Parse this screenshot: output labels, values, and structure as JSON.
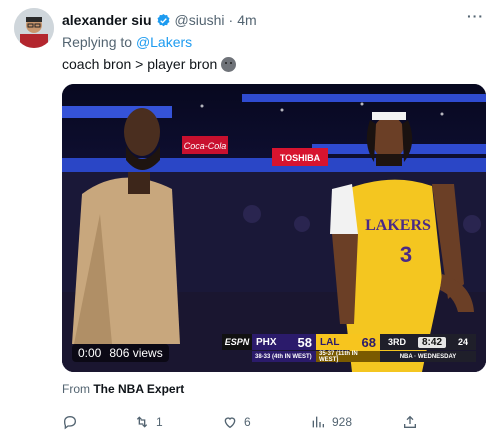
{
  "tweet": {
    "display_name": "alexander siu",
    "handle": "@siushi",
    "separator": "·",
    "time": "4m",
    "more": "···",
    "replying_prefix": "Replying to ",
    "replying_to": "@Lakers",
    "text": "coach bron > player bron",
    "emoji": "neutral-face-emoji"
  },
  "media": {
    "timestamp": "0:00",
    "views_overlay": "806 views",
    "banners": [
      "Coca-Cola",
      "TOSHIBA"
    ],
    "jersey": {
      "team": "LAKERS",
      "number": "3"
    },
    "scorebug": {
      "network": "ESPN",
      "team1": "PHX",
      "score1": "58",
      "record1": "38-33 (4th IN WEST)",
      "team2": "LAL",
      "score2": "68",
      "record2": "35-37 (11th IN WEST)",
      "period": "3RD",
      "clock": "8:42",
      "shot_clock": "24",
      "broadcast": "NBA · WEDNESDAY"
    }
  },
  "source": {
    "prefix": "From ",
    "name": "The NBA Expert"
  },
  "actions": {
    "reply_icon": "reply-icon",
    "retweet_icon": "retweet-icon",
    "retweets": "1",
    "like_icon": "like-icon",
    "likes": "6",
    "views_icon": "views-icon",
    "views": "928",
    "share_icon": "share-icon"
  },
  "colors": {
    "text": "#0f1419",
    "secondary": "#536471",
    "link": "#1d9bf0",
    "lakers_gold": "#f7c51e",
    "lakers_purple": "#2b1b6b"
  }
}
